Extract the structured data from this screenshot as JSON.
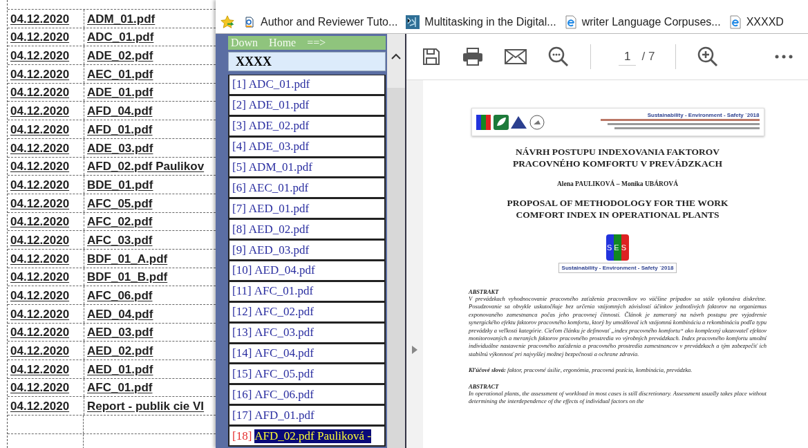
{
  "spreadsheet": {
    "rows": [
      {
        "date": "04.12.2020",
        "file": "ADM_01.pdf"
      },
      {
        "date": "04.12.2020",
        "file": "ADC_01.pdf"
      },
      {
        "date": "04.12.2020",
        "file": "ADE_02.pdf"
      },
      {
        "date": "04.12.2020",
        "file": "AEC_01.pdf"
      },
      {
        "date": "04.12.2020",
        "file": "ADE_01.pdf"
      },
      {
        "date": "04.12.2020",
        "file": "AFD_04.pdf"
      },
      {
        "date": "04.12.2020",
        "file": "AFD_01.pdf"
      },
      {
        "date": "04.12.2020",
        "file": "ADE_03.pdf"
      },
      {
        "date": "04.12.2020",
        "file": "AFD_02.pdf Paulikov"
      },
      {
        "date": "04.12.2020",
        "file": "BDE_01.pdf"
      },
      {
        "date": "04.12.2020",
        "file": "AFC_05.pdf"
      },
      {
        "date": "04.12.2020",
        "file": "AFC_02.pdf"
      },
      {
        "date": "04.12.2020",
        "file": "AFC_03.pdf"
      },
      {
        "date": "04.12.2020",
        "file": "BDF_01_A.pdf"
      },
      {
        "date": "04.12.2020",
        "file": "BDF_01_B.pdf"
      },
      {
        "date": "04.12.2020",
        "file": "AFC_06.pdf"
      },
      {
        "date": "04.12.2020",
        "file": "AED_04.pdf"
      },
      {
        "date": "04.12.2020",
        "file": "AED_03.pdf"
      },
      {
        "date": "04.12.2020",
        "file": "AED_02.pdf"
      },
      {
        "date": "04.12.2020",
        "file": "AED_01.pdf"
      },
      {
        "date": "04.12.2020",
        "file": "AFC_01.pdf"
      },
      {
        "date": "04.12.2020",
        "file": "Report - publik cie VI"
      }
    ]
  },
  "bookmarks": [
    {
      "kind": "tutorial",
      "label": "Author and Reviewer Tuto..."
    },
    {
      "kind": "tiles",
      "label": "Multitasking in the Digital..."
    },
    {
      "kind": "page",
      "label": "writer Language Corpuses..."
    },
    {
      "kind": "page",
      "label": "XXXXD"
    }
  ],
  "nav_frame": {
    "links": [
      "Down",
      "Home",
      "==>"
    ],
    "heading": "XXXX",
    "items": [
      {
        "number": "[1]",
        "label": "ADC_01.pdf",
        "selected": false
      },
      {
        "number": "[2]",
        "label": "ADE_01.pdf",
        "selected": false
      },
      {
        "number": "[3]",
        "label": "ADE_02.pdf",
        "selected": false
      },
      {
        "number": "[4]",
        "label": "ADE_03.pdf",
        "selected": false
      },
      {
        "number": "[5]",
        "label": "ADM_01.pdf",
        "selected": false
      },
      {
        "number": "[6]",
        "label": "AEC_01.pdf",
        "selected": false
      },
      {
        "number": "[7]",
        "label": "AED_01.pdf",
        "selected": false
      },
      {
        "number": "[8]",
        "label": "AED_02.pdf",
        "selected": false
      },
      {
        "number": "[9]",
        "label": "AED_03.pdf",
        "selected": false
      },
      {
        "number": "[10]",
        "label": "AED_04.pdf",
        "selected": false
      },
      {
        "number": "[11]",
        "label": "AFC_01.pdf",
        "selected": false
      },
      {
        "number": "[12]",
        "label": "AFC_02.pdf",
        "selected": false
      },
      {
        "number": "[13]",
        "label": "AFC_03.pdf",
        "selected": false
      },
      {
        "number": "[14]",
        "label": "AFC_04.pdf",
        "selected": false
      },
      {
        "number": "[15]",
        "label": "AFC_05.pdf",
        "selected": false
      },
      {
        "number": "[16]",
        "label": "AFC_06.pdf",
        "selected": false
      },
      {
        "number": "[17]",
        "label": "AFD_01.pdf",
        "selected": false
      },
      {
        "number": "[18]",
        "label": "AFD_02.pdf Pauliková -",
        "selected": true
      }
    ]
  },
  "pdf_viewer": {
    "page_number": "1",
    "page_count": "/ 7",
    "document": {
      "banner_title": "Sustainability - Environment - Safety ´2018",
      "title_sk": [
        "NÁVRH POSTUPU INDEXOVANIA FAKTOROV",
        "PRACOVNÉHO KOMFORTU V PREVÁDZKACH"
      ],
      "authors": "Alena PAULIKOVÁ – Monika UBÁROVÁ",
      "title_en": [
        "PROPOSAL OF METHODOLOGY FOR THE WORK",
        "COMFORT INDEX IN OPERATIONAL PLANTS"
      ],
      "logo_text": "SES",
      "logo_caption": "Sustainability - Environment - Safety ´2018",
      "abstract_sk_heading": "ABSTRAKT",
      "abstract_sk": "V prevádzkach vyhodnocovanie pracovného zaťaženia pracovníkov vo väčšine prípadov sa stále vykonáva diskrétne. Posudzovanie sa obvykle uskutočňuje bez určenia vzájomných závislostí účinkov jednotlivých faktorov na organizmus exponovaného zamestnanca počas jeho pracovnej činnosti. Článok je zameraný na návrh postupu pre vyjadrenie synergického efektu faktorov pracovného komfortu, ktorý by umožňoval ich vzájomnú kombináciu a rekombináciu podľa typu prevádzky a veľkosti kategórie. Cieľom článku je definovať „index pracovného komfortu“ ako komplexný ukazovateľ efektov monitorovaných a meraných faktorov pracovného prostredia vo výrobných prevádzkach. Index pracovného komfortu umožní individuálne nastavenie pracovného zaťaženia a pracovného prostredia zamestnancov v prevádzkach a tým zabezpečiť ich stabilnú výkonnosť pri najvyššej možnej bezpečnosti a ochrane zdravia.",
      "keywords": "**Kľúčové slová:** faktor, pracovné úsilie, ergonómia, pracovná pozícia, kombinácia, prevádzka.",
      "abstract_en_heading": "ABSTRACT",
      "abstract_en": "In operational plants, the assessment of workload in most cases is still discretionary. Assessment usually takes place without determining the interdependence of the effects of individual factors on the"
    }
  }
}
